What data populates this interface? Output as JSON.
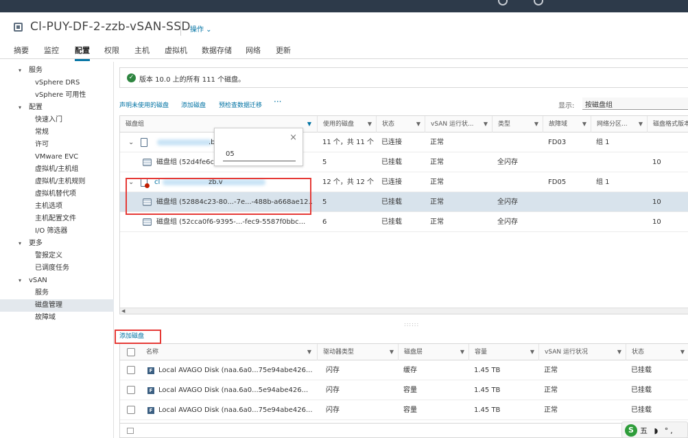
{
  "header": {
    "title": "Cl-PUY-DF-2-zzb-vSAN-SSD",
    "actions_label": "操作 ⌄"
  },
  "tabs": [
    "摘要",
    "监控",
    "配置",
    "权限",
    "主机",
    "虚拟机",
    "数据存储",
    "网络",
    "更新"
  ],
  "active_tab": "配置",
  "sidebar": {
    "services": "服务",
    "vsphere_drs": "vSphere DRS",
    "vsphere_ha": "vSphere 可用性",
    "config": "配置",
    "quickstart": "快速入门",
    "general": "常规",
    "license": "许可",
    "vmware_evc": "VMware EVC",
    "vm_host_groups": "虚拟机/主机组",
    "vm_host_rules": "虚拟机/主机规则",
    "vm_overrides": "虚拟机替代项",
    "host_options": "主机选项",
    "host_profile": "主机配置文件",
    "io_filters": "I/O 筛选器",
    "more": "更多",
    "alarm_defs": "警报定义",
    "scheduled_tasks": "已调度任务",
    "vsan": "vSAN",
    "vsan_services": "服务",
    "disk_management": "磁盘管理",
    "fault_domains": "故障域"
  },
  "banner": {
    "message": "版本 10.0 上的所有 111 个磁盘。"
  },
  "toolbar": {
    "claim_unused": "声明未使用的磁盘",
    "add_disks": "添加磁盘",
    "precheck_migration": "预检查数据迁移",
    "more": "···",
    "show_label": "显示:",
    "show_value": "按磁盘组"
  },
  "grid1": {
    "headers": [
      "磁盘组",
      "使用的磁盘",
      "状态",
      "vSAN 运行状...",
      "类型",
      "故障域",
      "网络分区...",
      "磁盘格式版本"
    ],
    "rows": [
      {
        "name": "g",
        "name_suffix": ".b",
        "disks": "11 个，共 11 个",
        "state": "已连接",
        "health": "正常",
        "type": "",
        "fault_domain": "FD03",
        "partition": "组 1",
        "format": ""
      },
      {
        "name": "磁盘组 (52d4fe6c-",
        "disks": "5",
        "state": "已挂载",
        "health": "正常",
        "type": "全闪存",
        "fault_domain": "",
        "partition": "",
        "format": "10"
      },
      {
        "name": "cl",
        "name_suffix": "zb.v",
        "disks": "12 个，共 12 个",
        "state": "已连接",
        "health": "正常",
        "type": "",
        "fault_domain": "FD05",
        "partition": "组 1",
        "format": ""
      },
      {
        "name": "磁盘组 (52884c23-80...-7e...-488b-a668ae12...",
        "disks": "5",
        "state": "已挂载",
        "health": "正常",
        "type": "全闪存",
        "fault_domain": "",
        "partition": "",
        "format": "10"
      },
      {
        "name": "磁盘组 (52cca0f6-9395-...-fec9-5587f0bbc...",
        "disks": "6",
        "state": "已挂载",
        "health": "正常",
        "type": "全闪存",
        "fault_domain": "",
        "partition": "",
        "format": "10"
      }
    ]
  },
  "filter_popup": {
    "value": "05"
  },
  "add_disk_link": "添加磁盘",
  "grid2": {
    "headers": [
      "名称",
      "驱动器类型",
      "磁盘层",
      "容量",
      "vSAN 运行状况",
      "状态"
    ],
    "rows": [
      {
        "name": "Local AVAGO Disk (naa.6a0...75e94abe426...",
        "drive": "闪存",
        "tier": "缓存",
        "capacity": "1.45 TB",
        "health": "正常",
        "state": "已挂载"
      },
      {
        "name": "Local AVAGO Disk (naa.6a0...5e94abe426...",
        "drive": "闪存",
        "tier": "容量",
        "capacity": "1.45 TB",
        "health": "正常",
        "state": "已挂载"
      },
      {
        "name": "Local AVAGO Disk (naa.6a0...75e94abe426...",
        "drive": "闪存",
        "tier": "容量",
        "capacity": "1.45 TB",
        "health": "正常",
        "state": "已挂载"
      }
    ]
  },
  "ime": {
    "logo": "S",
    "text": "五 ◗ °,"
  },
  "colors": {
    "accent": "#0072a3",
    "selected_row": "#d8e3ec",
    "highlight_box": "#e53935",
    "topbar": "#2d3a4a"
  }
}
